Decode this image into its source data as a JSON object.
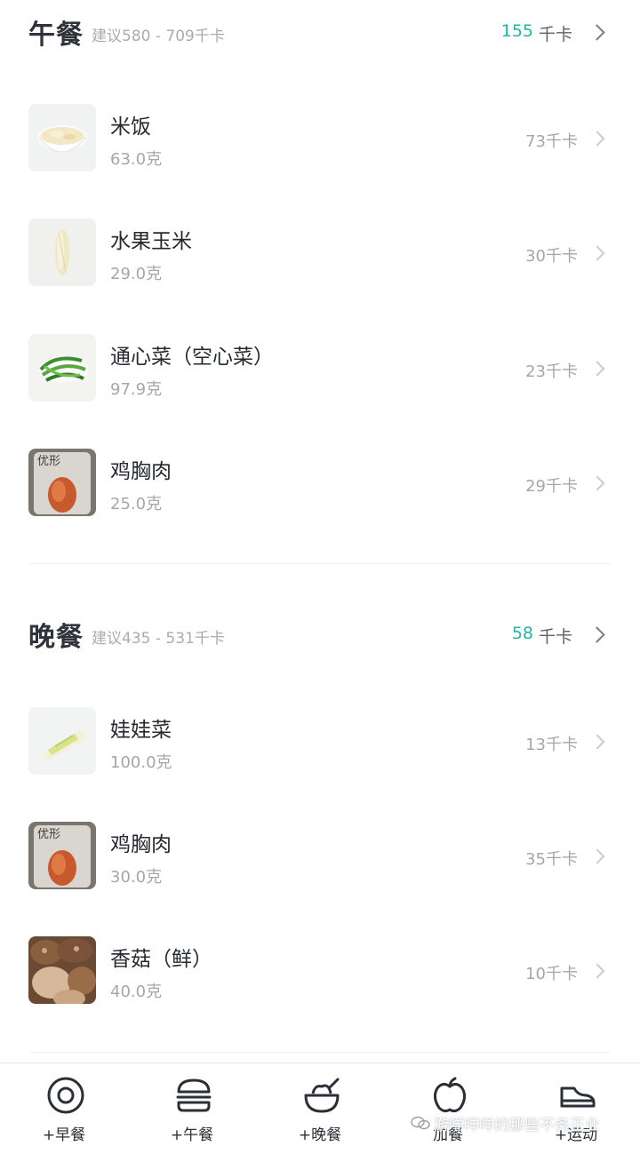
{
  "lunch": {
    "title": "午餐",
    "suggest": "建议580 - 709千卡",
    "kcal": "155",
    "unit": "千卡",
    "items": [
      {
        "name": "米饭",
        "weight": "63.0克",
        "kcal": "73千卡",
        "icon": "rice-bowl-icon"
      },
      {
        "name": "水果玉米",
        "weight": "29.0克",
        "kcal": "30千卡",
        "icon": "corn-icon"
      },
      {
        "name": "通心菜（空心菜）",
        "weight": "97.9克",
        "kcal": "23千卡",
        "icon": "greens-icon"
      },
      {
        "name": "鸡胸肉",
        "weight": "25.0克",
        "kcal": "29千卡",
        "icon": "chicken-pack-icon",
        "pack_text": "优形"
      }
    ]
  },
  "dinner": {
    "title": "晚餐",
    "suggest": "建议435 - 531千卡",
    "kcal": "58",
    "unit": "千卡",
    "items": [
      {
        "name": "娃娃菜",
        "weight": "100.0克",
        "kcal": "13千卡",
        "icon": "cabbage-icon"
      },
      {
        "name": "鸡胸肉",
        "weight": "30.0克",
        "kcal": "35千卡",
        "icon": "chicken-pack-icon",
        "pack_text": "优形"
      },
      {
        "name": "香菇（鲜）",
        "weight": "40.0克",
        "kcal": "10千卡",
        "icon": "mushroom-icon"
      }
    ]
  },
  "tabbar": {
    "breakfast": "+早餐",
    "lunch": "+午餐",
    "dinner": "+晚餐",
    "snack": "加餐",
    "exercise": "+运动"
  },
  "watermark": "游咩咩咩的那些不务正业",
  "colors": {
    "accent": "#25b3a6",
    "text": "#2b2f36",
    "muted": "#a3a7ad"
  }
}
